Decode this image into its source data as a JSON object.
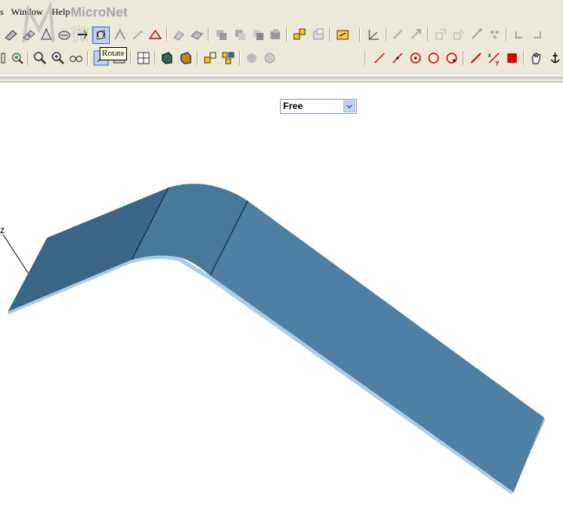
{
  "menu": {
    "items": [
      {
        "label": "s",
        "name": "menu-tools-partial"
      },
      {
        "label": "Window",
        "name": "menu-window"
      },
      {
        "label": "Help",
        "name": "menu-help"
      }
    ]
  },
  "watermark": {
    "text": "MicroNet"
  },
  "tooltip": {
    "text": "Rotate"
  },
  "view_select": {
    "value": "Free"
  },
  "axis": {
    "label": "z"
  },
  "colors": {
    "part_face": "#4f7fa2",
    "part_face_dark": "#3c6685",
    "part_edge": "#a9cdea",
    "toolbar_bg": "#ece9d8"
  }
}
